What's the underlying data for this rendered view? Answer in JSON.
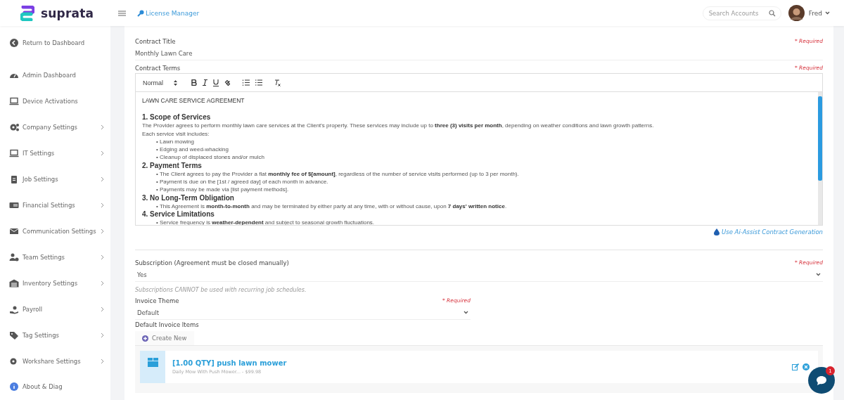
{
  "header": {
    "brand": "suprata",
    "breadcrumb": "License Manager",
    "search": {
      "placeholder": "Search Accounts"
    },
    "user": {
      "name": "Fred"
    }
  },
  "sidebar": {
    "items": [
      {
        "label": "Return to Dashboard",
        "has_submenu": false
      },
      {
        "label": "Admin Dashboard",
        "has_submenu": false
      },
      {
        "label": "Device Activations",
        "has_submenu": false
      },
      {
        "label": "Company Settings",
        "has_submenu": true
      },
      {
        "label": "IT Settings",
        "has_submenu": true
      },
      {
        "label": "Job Settings",
        "has_submenu": true
      },
      {
        "label": "Financial Settings",
        "has_submenu": true
      },
      {
        "label": "Communication Settings",
        "has_submenu": true
      },
      {
        "label": "Team Settings",
        "has_submenu": true
      },
      {
        "label": "Inventory Settings",
        "has_submenu": true
      },
      {
        "label": "Payroll",
        "has_submenu": true
      },
      {
        "label": "Tag Settings",
        "has_submenu": true
      },
      {
        "label": "Workshare Settings",
        "has_submenu": true
      },
      {
        "label": "About & Diag",
        "has_submenu": false
      }
    ]
  },
  "form": {
    "contract_title": {
      "label": "Contract Title",
      "required": "* Required",
      "value": "Monthly Lawn Care"
    },
    "contract_terms": {
      "label": "Contract Terms",
      "required": "* Required",
      "toolbar": {
        "format": "Normal"
      },
      "content": [
        {
          "kind": "title",
          "text": "LAWN CARE SERVICE AGREEMENT"
        },
        {
          "kind": "heading",
          "text": "1. Scope of Services"
        },
        {
          "kind": "para",
          "text": "The Provider agrees to perform monthly lawn care services at the Client's property. These services may include up to **three (3) visits per month**, depending on weather conditions and lawn growth patterns."
        },
        {
          "kind": "para",
          "text": "Each service visit includes:"
        },
        {
          "kind": "bullet",
          "text": "• Lawn mowing"
        },
        {
          "kind": "bullet",
          "text": "• Edging and weed-whacking"
        },
        {
          "kind": "bullet",
          "text": "• Cleanup of displaced stones and/or mulch"
        },
        {
          "kind": "heading",
          "text": "2. Payment Terms"
        },
        {
          "kind": "bullet",
          "text": "• The Client agrees to pay the Provider a flat **monthly fee of $[amount]**, regardless of the number of service visits performed (up to 3 per month)."
        },
        {
          "kind": "bullet",
          "text": "• Payment is due on the [1st / agreed day] of each month in advance."
        },
        {
          "kind": "bullet",
          "text": "• Payments may be made via [list payment methods]."
        },
        {
          "kind": "heading",
          "text": "3. No Long-Term Obligation"
        },
        {
          "kind": "bullet",
          "text": "• This Agreement is **month-to-month** and may be terminated by either party at any time, with or without cause, upon **7 days' written notice**."
        },
        {
          "kind": "heading",
          "text": "4. Service Limitations"
        },
        {
          "kind": "bullet",
          "text": "• Service frequency is **weather-dependent** and subject to seasonal growth fluctuations."
        }
      ],
      "ai_link": "Use Ai-Assist Contract Generation"
    },
    "subscription": {
      "label": "Subscription (Agreement must be closed manually)",
      "required": "* Required",
      "value": "Yes",
      "hint": "Subscriptions CANNOT be used with recurring job schedules."
    },
    "invoice_theme": {
      "label": "Invoice Theme",
      "required": "* Required",
      "value": "Default"
    },
    "invoice_items": {
      "label": "Default Invoice Items",
      "create_button": "Create New",
      "items": [
        {
          "title": "[1.00 QTY] push lawn mower",
          "subtitle": "Daily Mow With Push Mower... - $99.98"
        }
      ]
    }
  },
  "chat": {
    "badge": "1"
  }
}
